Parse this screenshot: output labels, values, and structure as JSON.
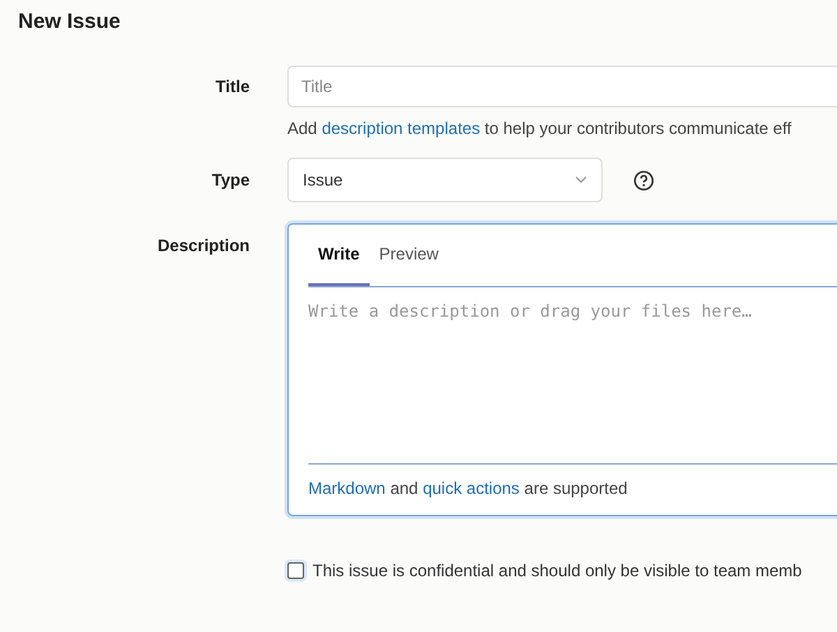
{
  "page": {
    "title": "New Issue"
  },
  "title_field": {
    "label": "Title",
    "placeholder": "Title"
  },
  "hint": [
    {
      "kind": "text",
      "text": "Add "
    },
    {
      "kind": "link",
      "text": "description templates"
    },
    {
      "kind": "text",
      "text": " to help your contributors communicate eff"
    }
  ],
  "type_field": {
    "label": "Type",
    "value": "Issue"
  },
  "description": {
    "label": "Description",
    "tabs": [
      {
        "label": "Write",
        "selected": true
      },
      {
        "label": "Preview",
        "selected": false
      }
    ],
    "placeholder": "Write a description or drag your files here…",
    "footer": [
      {
        "kind": "link",
        "text": "Markdown"
      },
      {
        "kind": "text",
        "text": " and "
      },
      {
        "kind": "link",
        "text": "quick actions"
      },
      {
        "kind": "text",
        "text": " are supported"
      }
    ]
  },
  "confidential": {
    "checked": false,
    "label": "This issue is confidential and should only be visible to team memb"
  }
}
